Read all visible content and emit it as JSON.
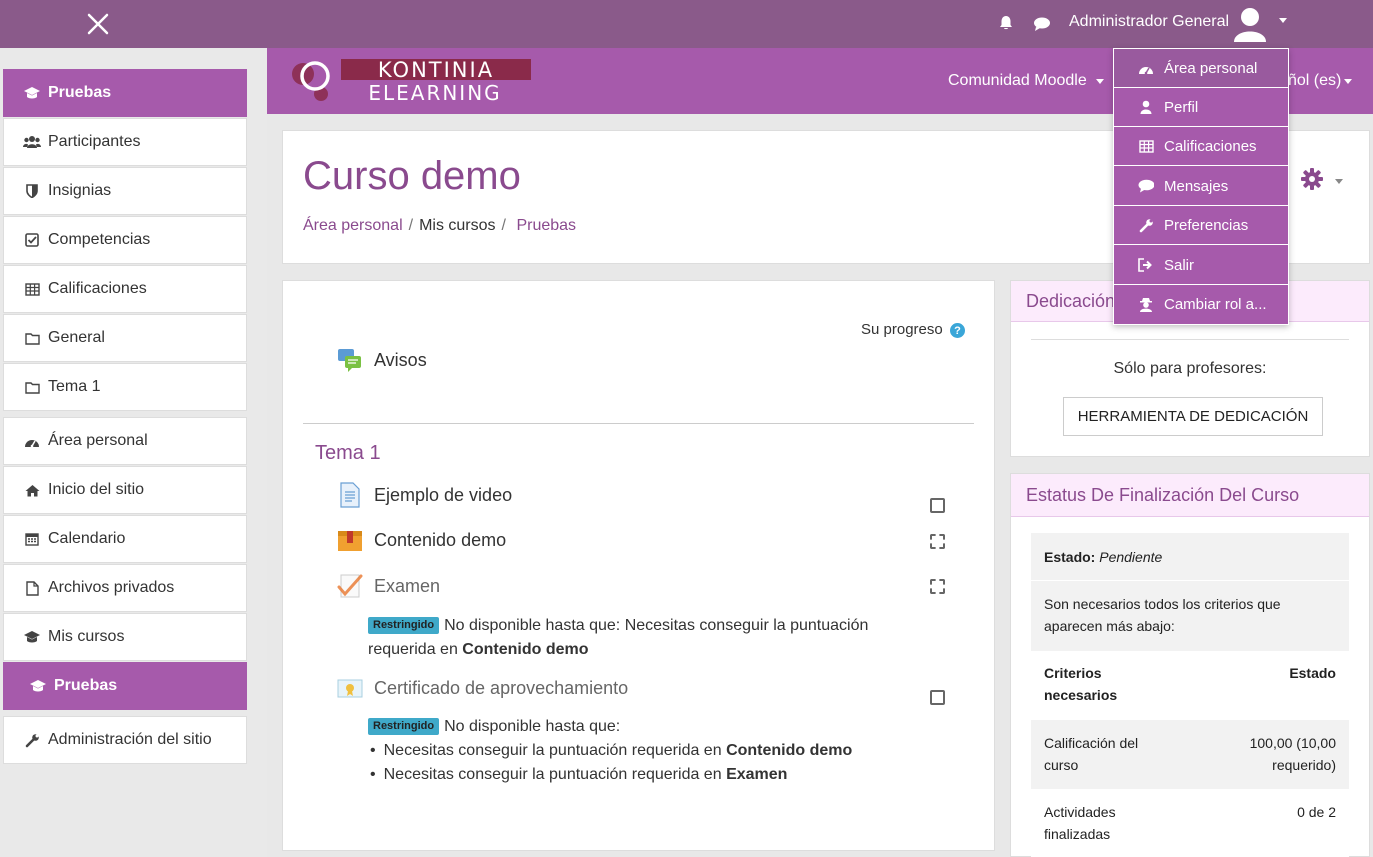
{
  "topbar": {
    "user_name": "Administrador General"
  },
  "brand": {
    "line1": "KONTINIA",
    "line2": "ELEARNING",
    "nav_comunidad": "Comunidad Moodle",
    "nav_lang": "ñol (es)"
  },
  "sidebar": {
    "items": [
      {
        "label": "Pruebas",
        "icon": "graduation-cap-icon"
      },
      {
        "label": "Participantes",
        "icon": "users-icon"
      },
      {
        "label": "Insignias",
        "icon": "shield-icon"
      },
      {
        "label": "Competencias",
        "icon": "check-square-icon"
      },
      {
        "label": "Calificaciones",
        "icon": "table-icon"
      },
      {
        "label": "General",
        "icon": "folder-icon"
      },
      {
        "label": "Tema 1",
        "icon": "folder-icon"
      },
      {
        "label": "Área personal",
        "icon": "dashboard-icon"
      },
      {
        "label": "Inicio del sitio",
        "icon": "home-icon"
      },
      {
        "label": "Calendario",
        "icon": "calendar-icon"
      },
      {
        "label": "Archivos privados",
        "icon": "file-icon"
      },
      {
        "label": "Mis cursos",
        "icon": "graduation-cap-icon"
      },
      {
        "label": "Pruebas",
        "icon": "graduation-cap-icon"
      },
      {
        "label": "Administración del sitio",
        "icon": "wrench-icon"
      }
    ]
  },
  "course": {
    "title": "Curso demo",
    "breadcrumb": [
      "Área personal",
      "Mis cursos",
      "Pruebas"
    ]
  },
  "content": {
    "progress_label": "Su progreso",
    "help_glyph": "?",
    "avisos": "Avisos",
    "section_title": "Tema 1",
    "activities": [
      {
        "label": "Ejemplo de video"
      },
      {
        "label": "Contenido demo"
      },
      {
        "label": "Examen"
      },
      {
        "label": "Certificado de aprovechamiento"
      }
    ],
    "restricted_badge": "Restringido",
    "examen_restriction": {
      "text1": "No disponible hasta que: Necesitas conseguir la puntuación",
      "text2": "requerida en",
      "bold": "Contenido demo"
    },
    "cert_restriction": {
      "intro": "No disponible hasta que:",
      "items": [
        {
          "text": "Necesitas conseguir la puntuación requerida en",
          "bold": "Contenido demo"
        },
        {
          "text": "Necesitas conseguir la puntuación requerida en",
          "bold": "Examen"
        }
      ]
    }
  },
  "dedicacion": {
    "title": "Dedicación",
    "label": "Sólo para profesores:",
    "button": "HERRAMIENTA DE DEDICACIÓN"
  },
  "completion": {
    "title": "Estatus De Finalización Del Curso",
    "estado_label": "Estado:",
    "estado_value": "Pendiente",
    "note_line1": "Son necesarios todos los criterios que",
    "note_line2": "aparecen más abajo:",
    "head_criteria_1": "Criterios",
    "head_criteria_2": "necesarios",
    "head_status": "Estado",
    "rows": [
      {
        "c1": "Calificación del",
        "c2": "curso",
        "s1": "100,00 (10,00",
        "s2": "requerido)"
      },
      {
        "c1": "Actividades",
        "c2": "finalizadas",
        "s1": "0 de 2",
        "s2": ""
      }
    ]
  },
  "user_menu": {
    "items": [
      {
        "label": "Área personal",
        "icon": "dashboard-icon"
      },
      {
        "label": "Perfil",
        "icon": "user-icon"
      },
      {
        "label": "Calificaciones",
        "icon": "table-icon"
      },
      {
        "label": "Mensajes",
        "icon": "comment-icon"
      },
      {
        "label": "Preferencias",
        "icon": "wrench-icon"
      },
      {
        "label": "Salir",
        "icon": "sign-out-icon"
      },
      {
        "label": "Cambiar rol a...",
        "icon": "user-secret-icon"
      }
    ]
  },
  "colors": {
    "topbar": "#8a5a8a",
    "brand": "#a65aab",
    "title": "#8a4a8e",
    "badge": "#3fa9c9"
  }
}
